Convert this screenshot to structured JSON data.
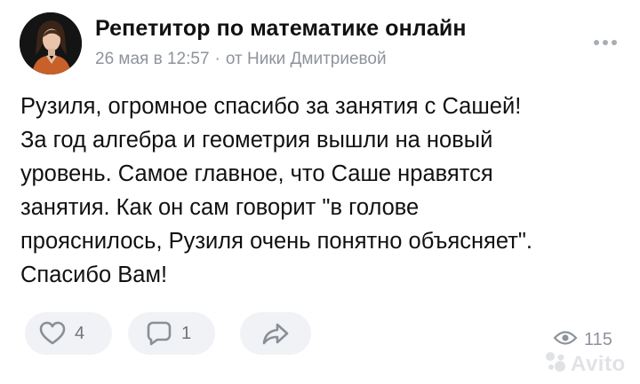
{
  "post": {
    "author_name": "Репетитор по математике онлайн",
    "date": "26 мая в 12:57",
    "separator": "·",
    "attribution": "от Ники Дмитриевой",
    "text": "Рузиля, огромное спасибо за занятия с Сашей!\nЗа год алгебра и геометрия вышли на новый\nуровень. Самое главное, что Саше нравятся\nзанятия. Как он сам говорит \"в голове\nпрояснилось, Рузиля очень понятно объясняет\".\nСпасибо Вам!"
  },
  "actions": {
    "likes": "4",
    "comments": "1",
    "views": "115"
  },
  "watermark": {
    "text": "Avito"
  },
  "icons": {
    "more": "more-horizontal-icon",
    "like": "heart-icon",
    "comment": "comment-icon",
    "share": "share-arrow-icon",
    "views": "eye-icon"
  },
  "colors": {
    "text": "#111111",
    "muted": "#8e939c",
    "pill_bg": "#f0f2f5",
    "icon": "#8a8f97"
  }
}
